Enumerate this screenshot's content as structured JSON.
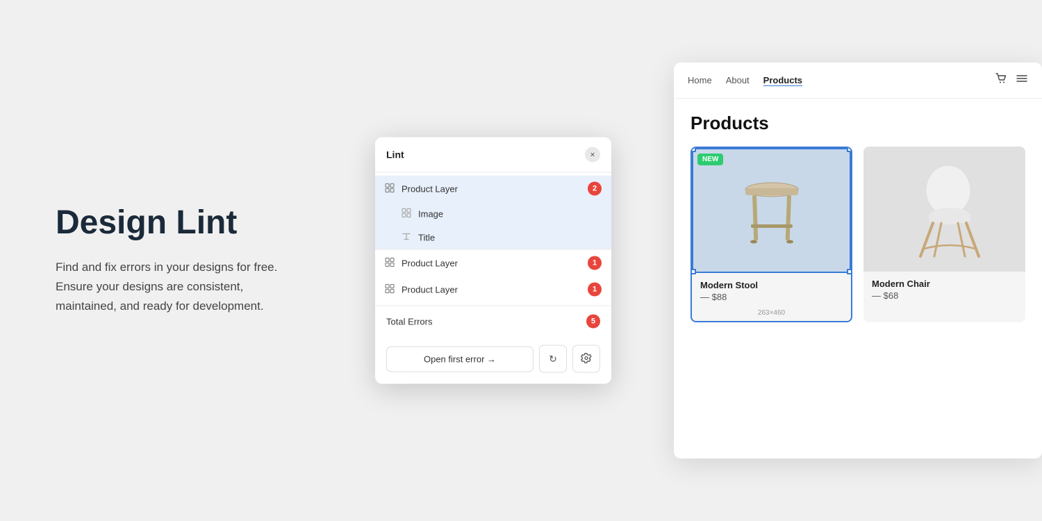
{
  "left": {
    "title": "Design Lint",
    "description": "Find and fix errors in your designs for free. Ensure your designs are consistent, maintained, and ready for development."
  },
  "lint_panel": {
    "title": "Lint",
    "close_label": "×",
    "layers": [
      {
        "id": "layer1",
        "label": "Product Layer",
        "badge": "2",
        "indent": 0,
        "highlighted": true,
        "icon": "grid"
      },
      {
        "id": "layer1-image",
        "label": "Image",
        "badge": null,
        "indent": 1,
        "highlighted": false,
        "icon": "grid"
      },
      {
        "id": "layer1-title",
        "label": "Title",
        "badge": null,
        "indent": 1,
        "highlighted": false,
        "icon": "text"
      },
      {
        "id": "layer2",
        "label": "Product Layer",
        "badge": "1",
        "indent": 0,
        "highlighted": false,
        "icon": "grid"
      },
      {
        "id": "layer3",
        "label": "Product Layer",
        "badge": "1",
        "indent": 0,
        "highlighted": false,
        "icon": "grid"
      }
    ],
    "footer": {
      "total_errors_label": "Total Errors",
      "total_errors_count": "5",
      "open_first_error_label": "Open first error →",
      "refresh_icon": "↻",
      "settings_icon": "⚙"
    }
  },
  "mockup": {
    "nav": {
      "links": [
        {
          "label": "Home",
          "active": false
        },
        {
          "label": "About",
          "active": false
        },
        {
          "label": "Products",
          "active": true
        }
      ]
    },
    "page_title": "Products",
    "products": [
      {
        "id": "stool",
        "name": "Modern Stool",
        "price": "— $88",
        "badge": "NEW",
        "selected": true,
        "dimensions": "263×460",
        "bg_color": "#ccdde8"
      },
      {
        "id": "chair",
        "name": "Modern Chair",
        "price": "— $68",
        "badge": null,
        "selected": false,
        "bg_color": "#e0e0e0"
      }
    ]
  }
}
